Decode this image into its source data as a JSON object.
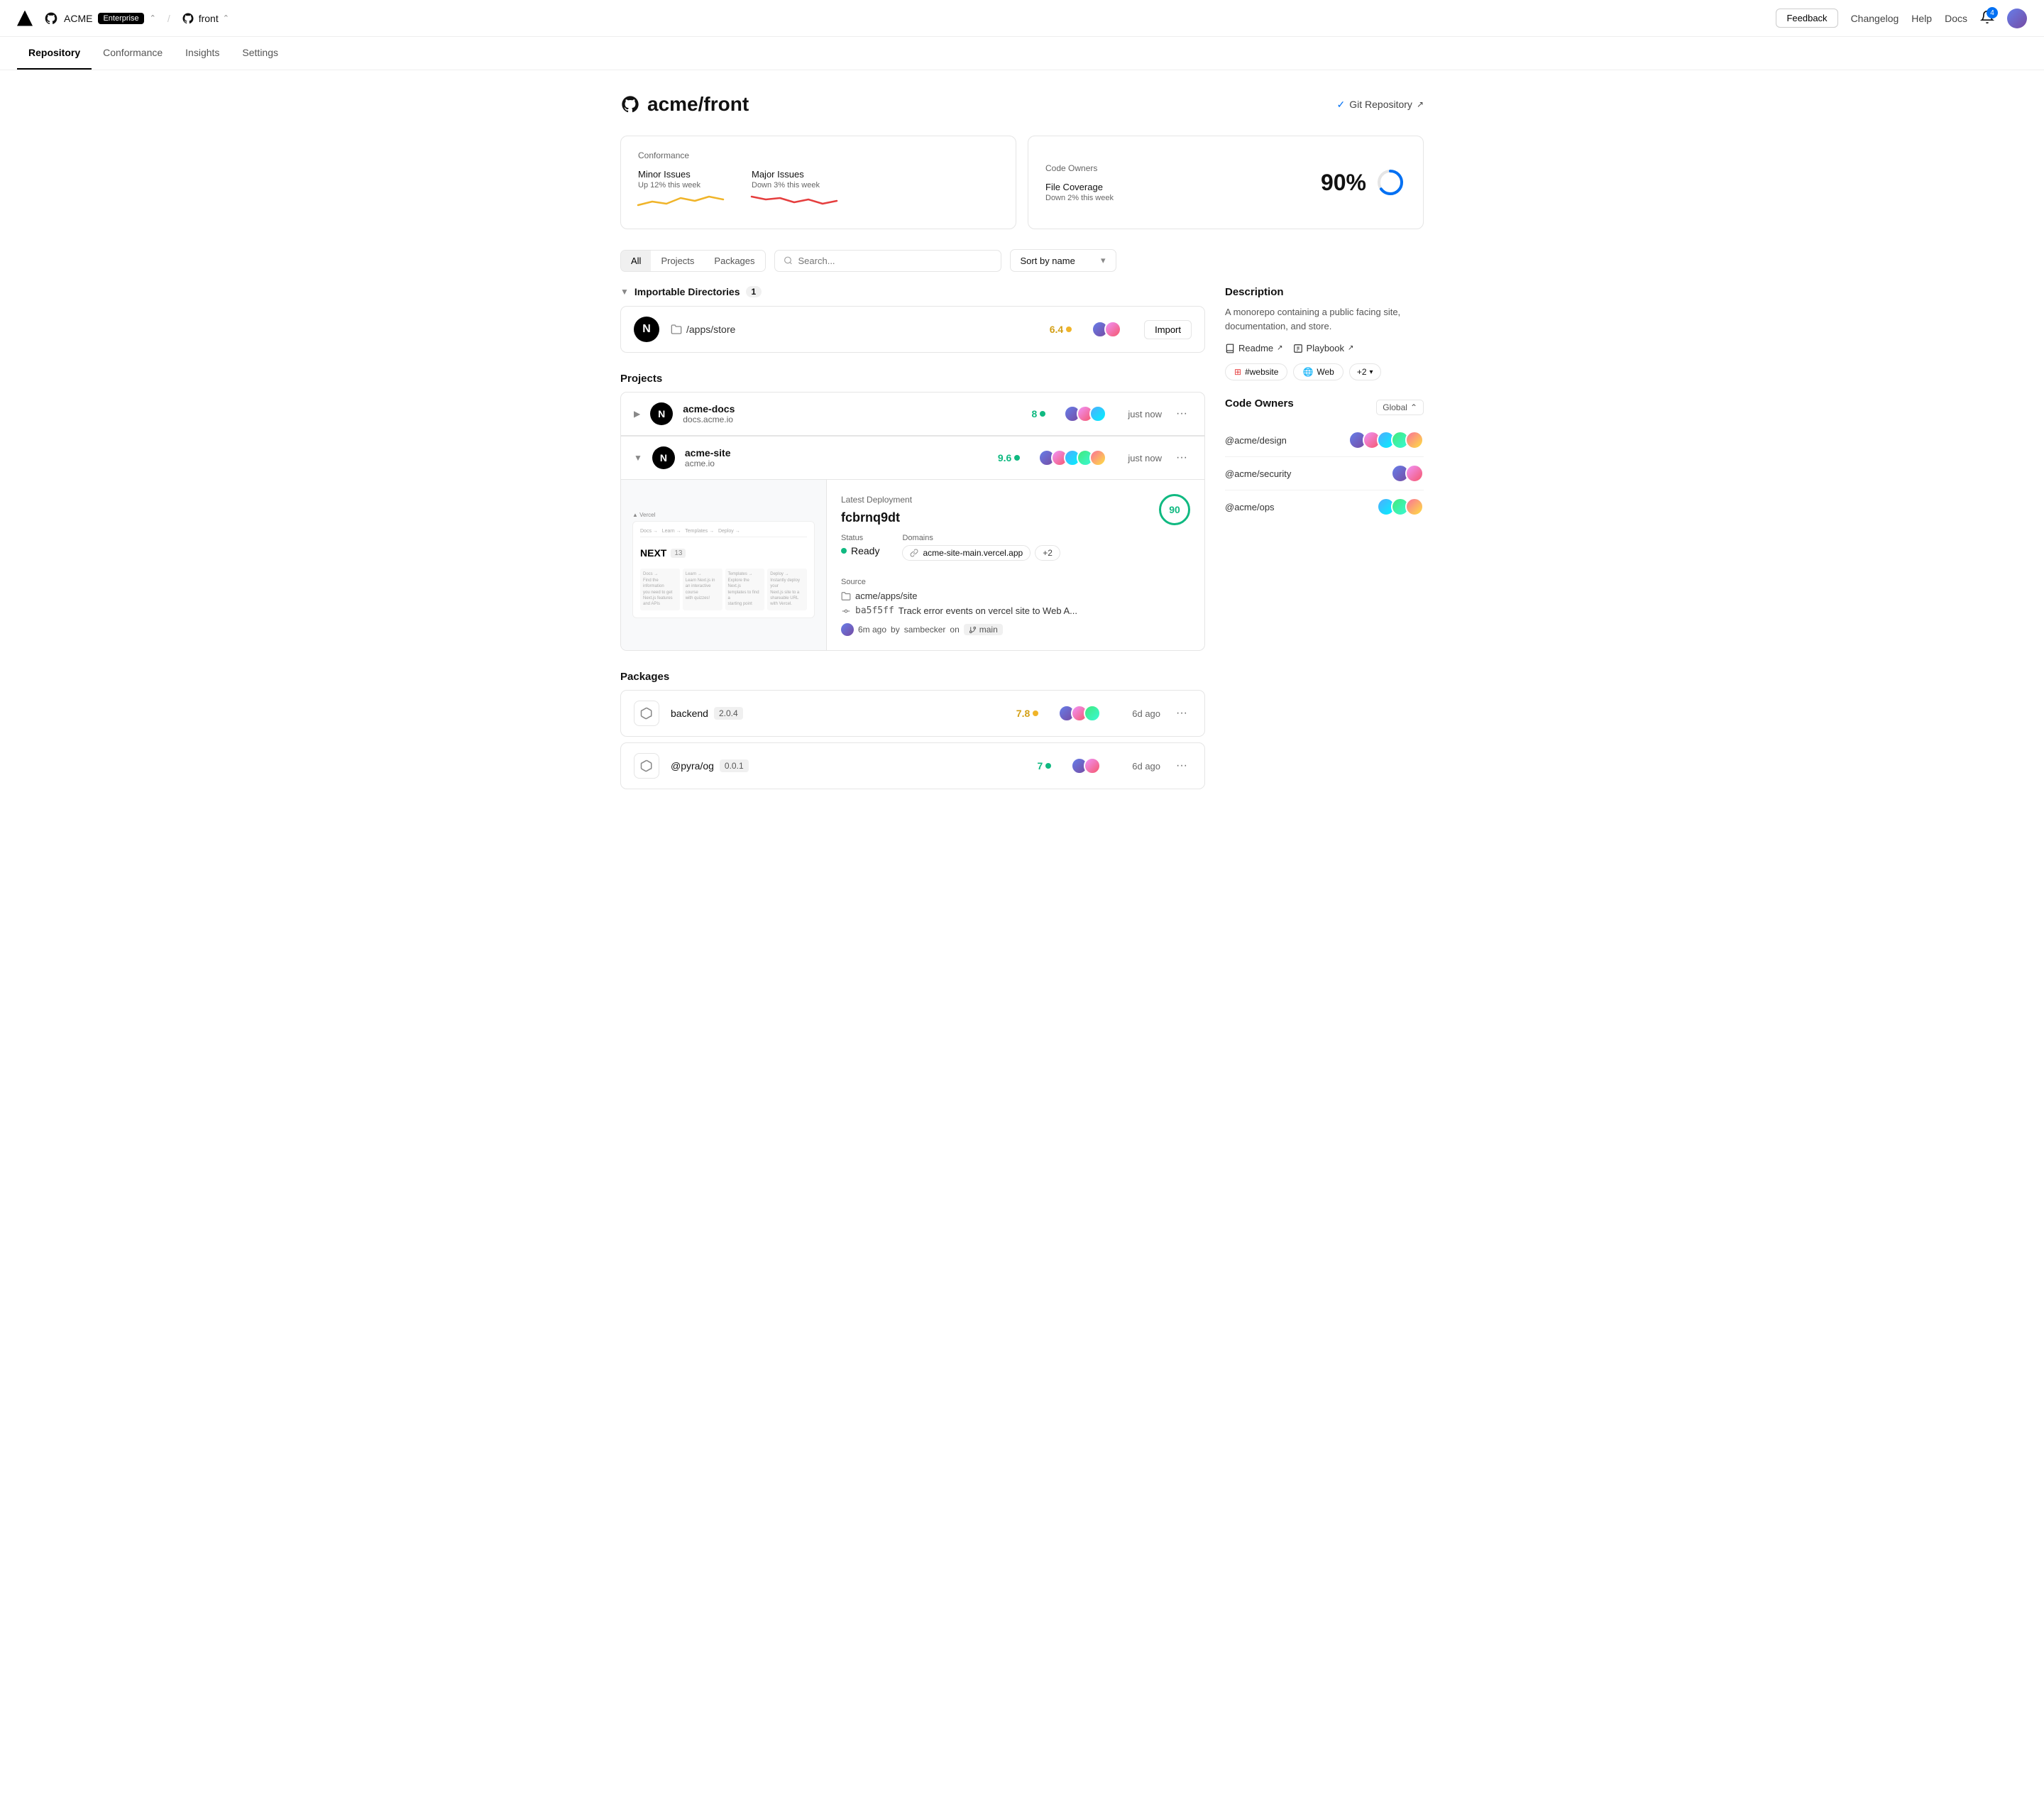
{
  "topNav": {
    "orgName": "ACME",
    "badge": "Enterprise",
    "repoName": "front",
    "feedbackLabel": "Feedback",
    "changelogLabel": "Changelog",
    "helpLabel": "Help",
    "docsLabel": "Docs",
    "notifCount": "4"
  },
  "subNav": {
    "items": [
      {
        "label": "Repository",
        "active": true
      },
      {
        "label": "Conformance",
        "active": false
      },
      {
        "label": "Insights",
        "active": false
      },
      {
        "label": "Settings",
        "active": false
      }
    ]
  },
  "pageTitle": "acme/front",
  "gitRepo": {
    "label": "Git Repository",
    "icon": "✓"
  },
  "conformanceCard": {
    "title": "Conformance",
    "minorIssues": {
      "label": "Minor Issues",
      "sub": "Up 12% this week"
    },
    "majorIssues": {
      "label": "Major Issues",
      "sub": "Down 3% this week"
    }
  },
  "codeOwnersCard": {
    "title": "Code Owners",
    "fileCoverage": {
      "label": "File Coverage",
      "sub": "Down 2% this week"
    },
    "percent": "90%"
  },
  "filters": {
    "tabs": [
      "All",
      "Projects",
      "Packages"
    ],
    "activeTab": "All",
    "searchPlaceholder": "Search...",
    "sortLabel": "Sort by name"
  },
  "importable": {
    "title": "Importable Directories",
    "count": "1",
    "items": [
      {
        "path": "/apps/store",
        "score": "6.4",
        "importLabel": "Import"
      }
    ]
  },
  "projects": {
    "title": "Projects",
    "items": [
      {
        "name": "acme-docs",
        "url": "docs.acme.io",
        "score": "8",
        "time": "just now"
      },
      {
        "name": "acme-site",
        "url": "acme.io",
        "score": "9.6",
        "time": "just now",
        "expanded": true
      }
    ],
    "deployment": {
      "label": "Latest Deployment",
      "hash": "fcbrnq9dt",
      "score": "90",
      "statusLabel": "Status",
      "statusValue": "Ready",
      "domainsLabel": "Domains",
      "domainValue": "acme-site-main.vercel.app",
      "plusDomains": "+2",
      "sourceLabel": "Source",
      "sourcePath": "acme/apps/site",
      "commitHash": "ba5f5ff",
      "commitMsg": "Track error events on vercel site to Web A...",
      "commitTime": "6m ago",
      "commitUser": "sambecker",
      "branchName": "main"
    }
  },
  "packages": {
    "title": "Packages",
    "items": [
      {
        "name": "backend",
        "version": "2.0.4",
        "score": "7.8",
        "time": "6d ago"
      },
      {
        "name": "@pyra/og",
        "version": "0.0.1",
        "score": "7",
        "time": "6d ago"
      }
    ]
  },
  "sidebar": {
    "description": {
      "title": "Description",
      "text": "A monorepo containing a public facing site, documentation, and store.",
      "readmeLabel": "Readme",
      "playbookLabel": "Playbook"
    },
    "tags": [
      "#website",
      "Web",
      "+2"
    ],
    "codeOwners": {
      "title": "Code Owners",
      "globalLabel": "Global",
      "owners": [
        {
          "name": "@acme/design"
        },
        {
          "name": "@acme/security"
        },
        {
          "name": "@acme/ops"
        }
      ]
    }
  }
}
